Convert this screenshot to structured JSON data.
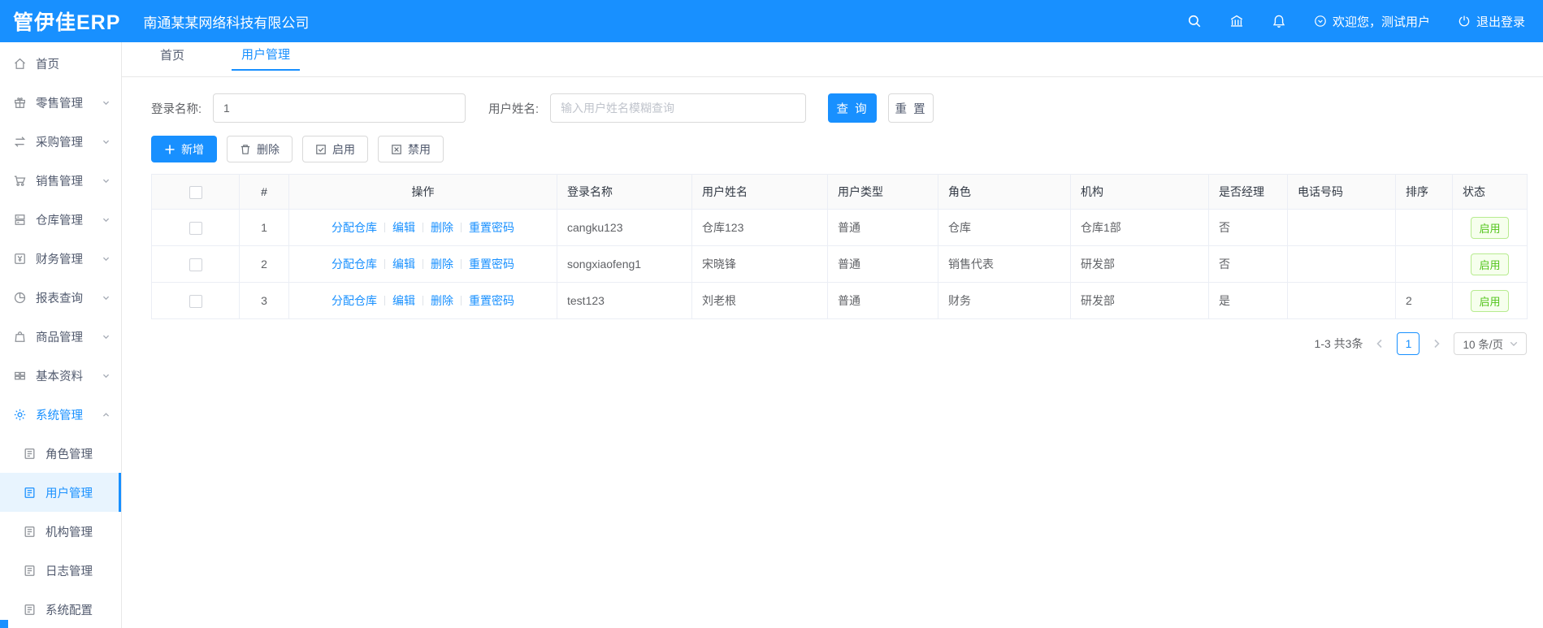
{
  "colors": {
    "primary": "#1890ff",
    "header_bg": "#1890ff",
    "active_menu_bg": "#e8f4fe",
    "status_green": "#52c41a",
    "status_green_bg": "#f6ffed",
    "status_green_border": "#b7eb8f"
  },
  "header": {
    "logo": "管伊佳ERP",
    "company": "南通某某网络科技有限公司",
    "welcome": "欢迎您，测试用户",
    "logout": "退出登录"
  },
  "sidebar": {
    "items": [
      {
        "label": "首页",
        "icon": "home-icon"
      },
      {
        "label": "零售管理",
        "icon": "retail-icon"
      },
      {
        "label": "采购管理",
        "icon": "purchase-icon"
      },
      {
        "label": "销售管理",
        "icon": "sales-icon"
      },
      {
        "label": "仓库管理",
        "icon": "warehouse-icon"
      },
      {
        "label": "财务管理",
        "icon": "finance-icon"
      },
      {
        "label": "报表查询",
        "icon": "report-icon"
      },
      {
        "label": "商品管理",
        "icon": "goods-icon"
      },
      {
        "label": "基本资料",
        "icon": "basic-data-icon"
      },
      {
        "label": "系统管理",
        "icon": "system-icon"
      }
    ],
    "subitems": [
      {
        "label": "角色管理"
      },
      {
        "label": "用户管理",
        "selected": true
      },
      {
        "label": "机构管理"
      },
      {
        "label": "日志管理"
      },
      {
        "label": "系统配置"
      }
    ]
  },
  "tabs": [
    {
      "label": "首页"
    },
    {
      "label": "用户管理",
      "active": true
    }
  ],
  "filters": {
    "login_name_label": "登录名称:",
    "login_name_value": "1",
    "user_name_label": "用户姓名:",
    "user_name_placeholder": "输入用户姓名模糊查询",
    "search_label": "查 询",
    "reset_label": "重 置"
  },
  "toolbar": {
    "add_label": "新增",
    "delete_label": "删除",
    "enable_label": "启用",
    "disable_label": "禁用"
  },
  "table": {
    "columns": [
      "#",
      "操作",
      "登录名称",
      "用户姓名",
      "用户类型",
      "角色",
      "机构",
      "是否经理",
      "电话号码",
      "排序",
      "状态"
    ],
    "action_labels": [
      "分配仓库",
      "编辑",
      "删除",
      "重置密码"
    ],
    "rows": [
      {
        "index": "1",
        "login": "cangku123",
        "name": "仓库123",
        "type": "普通",
        "role": "仓库",
        "org": "仓库1部",
        "manager": "否",
        "phone": "",
        "sort": "",
        "status": "启用"
      },
      {
        "index": "2",
        "login": "songxiaofeng1",
        "name": "宋晓锋",
        "type": "普通",
        "role": "销售代表",
        "org": "研发部",
        "manager": "否",
        "phone": "",
        "sort": "",
        "status": "启用"
      },
      {
        "index": "3",
        "login": "test123",
        "name": "刘老根",
        "type": "普通",
        "role": "财务",
        "org": "研发部",
        "manager": "是",
        "phone": "",
        "sort": "2",
        "status": "启用"
      }
    ]
  },
  "pagination": {
    "summary": "1-3 共3条",
    "page": "1",
    "page_size": "10 条/页"
  }
}
